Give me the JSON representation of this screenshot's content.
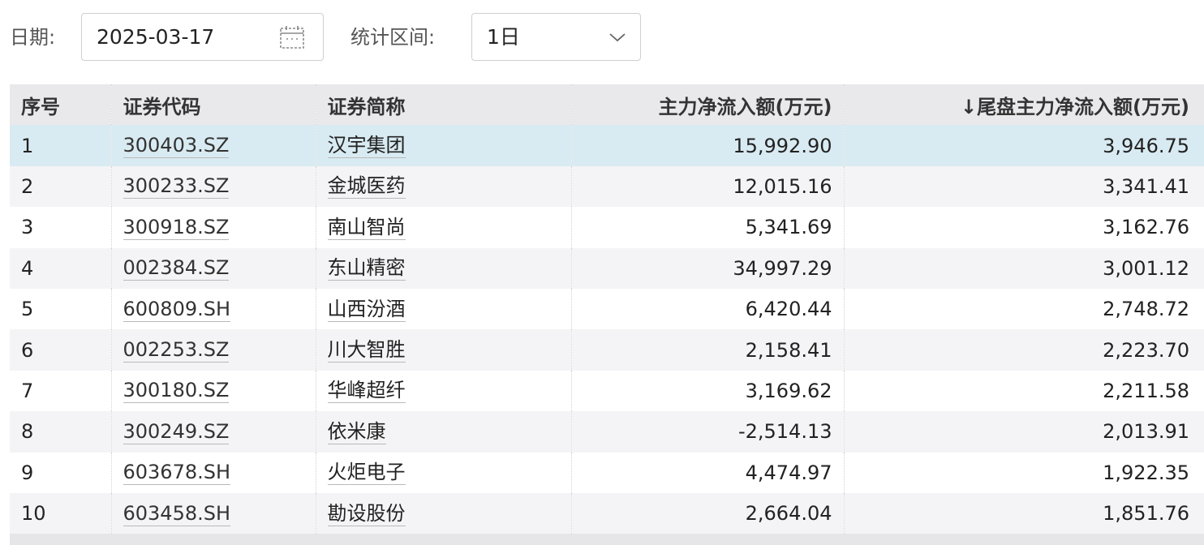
{
  "filters": {
    "date_label": "日期:",
    "date_value": "2025-03-17",
    "date_icon": "calendar-icon",
    "range_label": "统计区间:",
    "range_value": "1日",
    "range_icon": "chevron-down-icon"
  },
  "table": {
    "columns": [
      "序号",
      "证券代码",
      "证券简称",
      "主力净流入额(万元)",
      "↓尾盘主力净流入额(万元)"
    ],
    "sort": {
      "column": "尾盘主力净流入额(万元)",
      "direction": "desc"
    },
    "rows": [
      {
        "index": "1",
        "code": "300403.SZ",
        "name": "汉宇集团",
        "main_net_inflow": "15,992.90",
        "tail_main_net_inflow": "3,946.75"
      },
      {
        "index": "2",
        "code": "300233.SZ",
        "name": "金城医药",
        "main_net_inflow": "12,015.16",
        "tail_main_net_inflow": "3,341.41"
      },
      {
        "index": "3",
        "code": "300918.SZ",
        "name": "南山智尚",
        "main_net_inflow": "5,341.69",
        "tail_main_net_inflow": "3,162.76"
      },
      {
        "index": "4",
        "code": "002384.SZ",
        "name": "东山精密",
        "main_net_inflow": "34,997.29",
        "tail_main_net_inflow": "3,001.12"
      },
      {
        "index": "5",
        "code": "600809.SH",
        "name": "山西汾酒",
        "main_net_inflow": "6,420.44",
        "tail_main_net_inflow": "2,748.72"
      },
      {
        "index": "6",
        "code": "002253.SZ",
        "name": "川大智胜",
        "main_net_inflow": "2,158.41",
        "tail_main_net_inflow": "2,223.70"
      },
      {
        "index": "7",
        "code": "300180.SZ",
        "name": "华峰超纤",
        "main_net_inflow": "3,169.62",
        "tail_main_net_inflow": "2,211.58"
      },
      {
        "index": "8",
        "code": "300249.SZ",
        "name": "依米康",
        "main_net_inflow": "-2,514.13",
        "tail_main_net_inflow": "2,013.91"
      },
      {
        "index": "9",
        "code": "603678.SH",
        "name": "火炬电子",
        "main_net_inflow": "4,474.97",
        "tail_main_net_inflow": "1,922.35"
      },
      {
        "index": "10",
        "code": "603458.SH",
        "name": "勘设股份",
        "main_net_inflow": "2,664.04",
        "tail_main_net_inflow": "1,851.76"
      }
    ],
    "selected_row": "1"
  },
  "colors": {
    "header_bg": "#e9e9ec",
    "selected_row_bg": "#d9ebf2",
    "stripe_bg": "#f4f4f6",
    "border": "#cfcfcf"
  }
}
